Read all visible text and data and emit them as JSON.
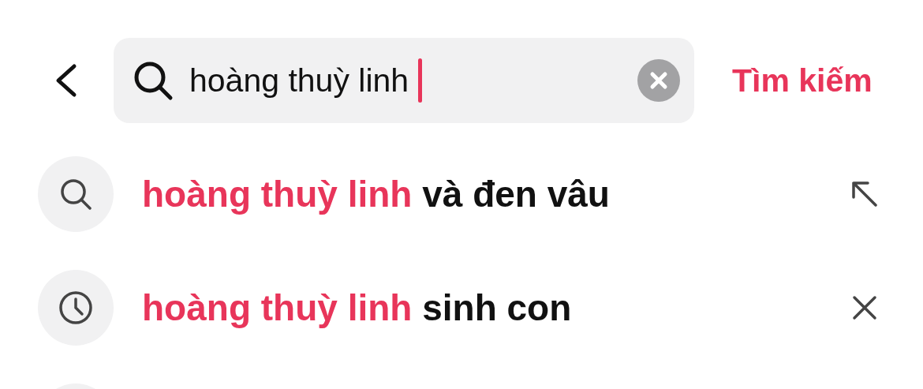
{
  "search": {
    "value": "hoàng thuỳ linh",
    "submit": "Tìm kiếm"
  },
  "suggestions": [
    {
      "kind": "suggestion",
      "match": "hoàng thuỳ linh",
      "rest": "và đen vâu"
    },
    {
      "kind": "history",
      "match": "hoàng thuỳ linh",
      "rest": "sinh con"
    }
  ]
}
